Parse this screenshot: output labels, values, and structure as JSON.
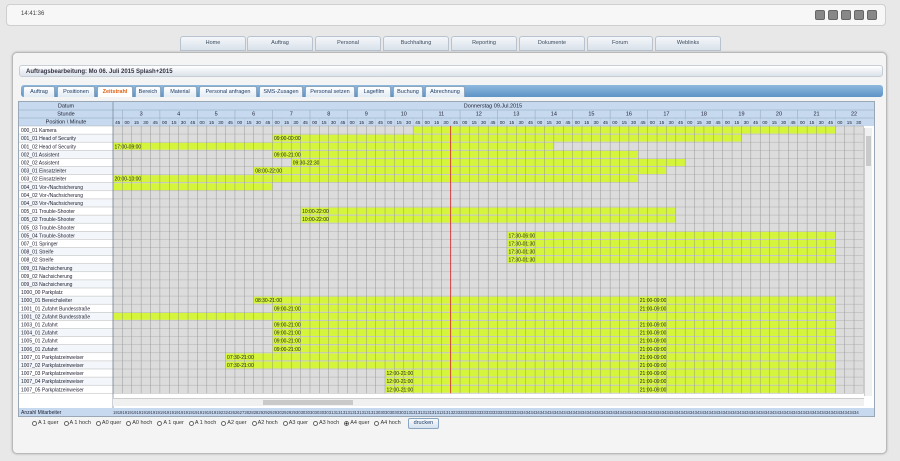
{
  "header": {
    "time": "14:41:36"
  },
  "nav": [
    "Home",
    "Auftrag",
    "Personal",
    "Buchhaltung",
    "Reporting",
    "Dokumente",
    "Forum",
    "Weblinks"
  ],
  "page_title": "Auftragsbearbeitung: Mo 06. Juli 2015 Splash+2015",
  "subtabs": [
    "Auftrag",
    "Positionen",
    "Zeitstrahl",
    "Bereich",
    "Material",
    "Personal anfragen",
    "SMS-Zusagen",
    "Personal setzen",
    "Lagefilm",
    "Buchung",
    "Abrechnung"
  ],
  "active_subtab": "Zeitstrahl",
  "grid": {
    "date_label": "Datum",
    "date_value": "Donnerstag 09.Jul.2015",
    "hour_label": "Stunde",
    "minute_label": "Position \\ Minute",
    "hours": [
      "3",
      "4",
      "5",
      "6",
      "7",
      "8",
      "9",
      "10",
      "11",
      "12",
      "13",
      "14",
      "15",
      "16",
      "17",
      "18",
      "19",
      "20",
      "21",
      "22"
    ],
    "minutes": [
      "45",
      "00",
      "15",
      "30"
    ],
    "footer_label": "Anzahl Mitarbeiter",
    "footer_values": [
      "19",
      "19",
      "19",
      "19",
      "19",
      "19",
      "19",
      "19",
      "19",
      "19",
      "19",
      "19",
      "19",
      "19",
      "19",
      "19",
      "19",
      "19",
      "19",
      "19",
      "19",
      "19",
      "19",
      "23",
      "24",
      "26",
      "26",
      "27",
      "28",
      "28",
      "28",
      "29",
      "29",
      "29",
      "29",
      "30",
      "29",
      "29",
      "29",
      "30",
      "30",
      "30",
      "30",
      "30",
      "30",
      "30",
      "31",
      "31",
      "31",
      "31",
      "31",
      "31",
      "31",
      "31",
      "31",
      "31",
      "30",
      "30",
      "30",
      "30",
      "30",
      "30",
      "31",
      "31",
      "31",
      "31",
      "31",
      "31",
      "31",
      "31",
      "31",
      "31",
      "32",
      "33",
      "33",
      "33",
      "33",
      "33",
      "33",
      "33",
      "33",
      "33",
      "33",
      "33",
      "33",
      "33",
      "34",
      "34",
      "34",
      "34",
      "34",
      "34",
      "34",
      "34",
      "34",
      "34",
      "34",
      "34",
      "34",
      "34",
      "34",
      "34",
      "34",
      "34",
      "34",
      "34",
      "34",
      "34",
      "34",
      "34",
      "34",
      "34",
      "34",
      "34",
      "34",
      "34",
      "34",
      "34",
      "34",
      "34",
      "34",
      "34",
      "34",
      "34",
      "34",
      "34",
      "34",
      "34",
      "34",
      "34",
      "34",
      "34",
      "34",
      "34",
      "34",
      "34",
      "34",
      "34",
      "34",
      "34",
      "34",
      "34",
      "34",
      "34",
      "34",
      "34",
      "34",
      "34",
      "34",
      "34",
      "34",
      "34",
      "34",
      "34",
      "34",
      "34",
      "34",
      "34",
      "34"
    ],
    "rows": [
      {
        "name": "000_01 Kamera",
        "bars": [
          {
            "start": "10:45",
            "end": "22:00",
            "label": ""
          }
        ]
      },
      {
        "name": "001_01 Head of Security",
        "bars": [
          {
            "start": "7:00",
            "end": "19:30",
            "label": "09:00-00:00"
          }
        ]
      },
      {
        "name": "001_02 Head of Security",
        "bars": [
          {
            "start": "2:45",
            "end": "14:30",
            "label": "17:00-09:00"
          }
        ]
      },
      {
        "name": "002_01 Assistent",
        "bars": [
          {
            "start": "7:00",
            "end": "16:45",
            "label": "09:00-21:00"
          }
        ]
      },
      {
        "name": "002_02 Assistent",
        "bars": [
          {
            "start": "7:30",
            "end": "18:00",
            "label": "09:30-22:30"
          }
        ]
      },
      {
        "name": "003_01 Einsatzleiter",
        "bars": [
          {
            "start": "6:30",
            "end": "17:30",
            "label": "08:00-22:00"
          }
        ]
      },
      {
        "name": "003_02 Einsatzleiter",
        "bars": [
          {
            "start": "2:45",
            "end": "16:45",
            "label": "20:00-10:00"
          }
        ]
      },
      {
        "name": "004_01 Vor-/Nachsicherung",
        "bars": [
          {
            "start": "2:45",
            "end": "7:00",
            "label": ""
          }
        ]
      },
      {
        "name": "004_02 Vor-/Nachsicherung",
        "bars": []
      },
      {
        "name": "004_03 Vor-/Nachsicherung",
        "bars": []
      },
      {
        "name": "005_01 Trouble-Shooter",
        "bars": [
          {
            "start": "7:45",
            "end": "17:45",
            "label": "10:00-22:00"
          }
        ]
      },
      {
        "name": "005_02 Trouble-Shooter",
        "bars": [
          {
            "start": "7:45",
            "end": "17:45",
            "label": "10:00-22:00"
          }
        ]
      },
      {
        "name": "005_03 Trouble-Shooter",
        "bars": []
      },
      {
        "name": "005_04 Trouble-Shooter",
        "bars": [
          {
            "start": "13:15",
            "end": "22:00",
            "label": "17:30-06:00"
          }
        ]
      },
      {
        "name": "007_01 Springer",
        "bars": [
          {
            "start": "13:15",
            "end": "22:00",
            "label": "17:30-01:30"
          }
        ]
      },
      {
        "name": "008_01 Streife",
        "bars": [
          {
            "start": "13:15",
            "end": "22:00",
            "label": "17:30-01:30"
          }
        ]
      },
      {
        "name": "008_02 Streife",
        "bars": [
          {
            "start": "13:15",
            "end": "22:00",
            "label": "17:30-01:30"
          }
        ]
      },
      {
        "name": "009_01 Nachsicherung",
        "bars": []
      },
      {
        "name": "009_02 Nachsicherung",
        "bars": []
      },
      {
        "name": "009_03 Nachsicherung",
        "bars": []
      },
      {
        "name": "1000_00 Parkplatz",
        "bars": []
      },
      {
        "name": "1000_01 Bereichsleiter",
        "bars": [
          {
            "start": "6:30",
            "end": "22:00",
            "label": "08:30-21:00"
          },
          {
            "start": "16:45",
            "end": "22:00",
            "label": "21:00-09:00"
          }
        ]
      },
      {
        "name": "1001_01 Zufahrt Bundesstraße",
        "bars": [
          {
            "start": "7:00",
            "end": "22:00",
            "label": "09:00-21:00"
          },
          {
            "start": "16:45",
            "end": "22:00",
            "label": "21:00-09:00"
          }
        ]
      },
      {
        "name": "1001_02 Zufahrt Bundesstraße",
        "bars": [
          {
            "start": "2:45",
            "end": "22:00",
            "label": ""
          }
        ]
      },
      {
        "name": "1003_01 Zufahrt",
        "bars": [
          {
            "start": "7:00",
            "end": "22:00",
            "label": "09:00-21:00"
          },
          {
            "start": "16:45",
            "end": "22:00",
            "label": "21:00-09:00"
          }
        ]
      },
      {
        "name": "1004_01 Zufahrt",
        "bars": [
          {
            "start": "7:00",
            "end": "22:00",
            "label": "09:00-21:00"
          },
          {
            "start": "16:45",
            "end": "22:00",
            "label": "21:00-09:00"
          }
        ]
      },
      {
        "name": "1005_01 Zufahrt",
        "bars": [
          {
            "start": "7:00",
            "end": "22:00",
            "label": "09:00-21:00"
          },
          {
            "start": "16:45",
            "end": "22:00",
            "label": "21:00-09:00"
          }
        ]
      },
      {
        "name": "1006_01 Zufahrt",
        "bars": [
          {
            "start": "7:00",
            "end": "22:00",
            "label": "09:00-21:00"
          },
          {
            "start": "16:45",
            "end": "22:00",
            "label": "21:00-09:00"
          }
        ]
      },
      {
        "name": "1007_01 Parkplatzeinweiser",
        "bars": [
          {
            "start": "5:45",
            "end": "22:00",
            "label": "07:30-21:00"
          },
          {
            "start": "16:45",
            "end": "22:00",
            "label": "21:00-09:00"
          }
        ]
      },
      {
        "name": "1007_02 Parkplatzeinweiser",
        "bars": [
          {
            "start": "5:45",
            "end": "22:00",
            "label": "07:30-21:00"
          },
          {
            "start": "16:45",
            "end": "22:00",
            "label": "21:00-09:00"
          }
        ]
      },
      {
        "name": "1007_03 Parkplatzeinweiser",
        "bars": [
          {
            "start": "10:00",
            "end": "22:00",
            "label": "12:00-21:00"
          },
          {
            "start": "16:45",
            "end": "22:00",
            "label": "21:00-09:00"
          }
        ]
      },
      {
        "name": "1007_04 Parkplatzeinweiser",
        "bars": [
          {
            "start": "10:00",
            "end": "22:00",
            "label": "12:00-21:00"
          },
          {
            "start": "16:45",
            "end": "22:00",
            "label": "21:00-09:00"
          }
        ]
      },
      {
        "name": "1007_05 Parkplatzeinweiser",
        "bars": [
          {
            "start": "10:00",
            "end": "22:00",
            "label": "12:00-21:00"
          },
          {
            "start": "16:45",
            "end": "22:00",
            "label": "21:00-09:00"
          }
        ]
      }
    ]
  },
  "print_options": [
    "A 1 quer",
    "A 1 hoch",
    "A0 quer",
    "A0 hoch",
    "A 1 quer",
    "A 1 hoch",
    "A2 quer",
    "A2 hoch",
    "A3 quer",
    "A3 hoch",
    "A4 quer",
    "A4 hoch"
  ],
  "selected_print": "A4 quer",
  "print_button": "drucken",
  "colors": {
    "bar": "#d4f53b",
    "grid_bg": "#dcdcdc",
    "header_bg": "#c6d9ef",
    "now_line": "#d42020"
  },
  "current_time_marker": "11:45"
}
